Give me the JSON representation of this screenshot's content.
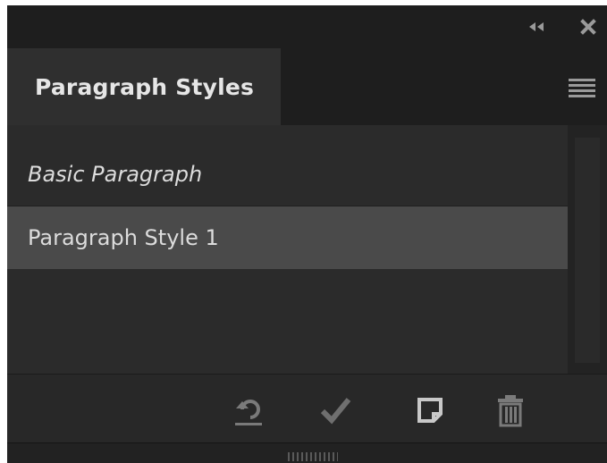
{
  "panel": {
    "title_bar": {
      "collapse_icon": "double-chevron-left-icon",
      "close_icon": "close-icon"
    },
    "tab": {
      "label": "Paragraph Styles"
    },
    "menu_icon": "hamburger-menu-icon",
    "styles": [
      {
        "label": "Basic Paragraph",
        "italic": true,
        "selected": false
      },
      {
        "label": "Paragraph Style 1",
        "italic": false,
        "selected": true
      }
    ],
    "toolbar": {
      "icons": [
        "redefine-style-icon",
        "checkmark-icon",
        "new-style-icon",
        "trash-icon"
      ]
    }
  },
  "colors": {
    "panel_bg": "#262626",
    "tab_active_bg": "#2f2f2f",
    "selected_row_bg": "#4a4a4a",
    "text": "#dcdcdc",
    "icon": "#8c8c8c"
  }
}
